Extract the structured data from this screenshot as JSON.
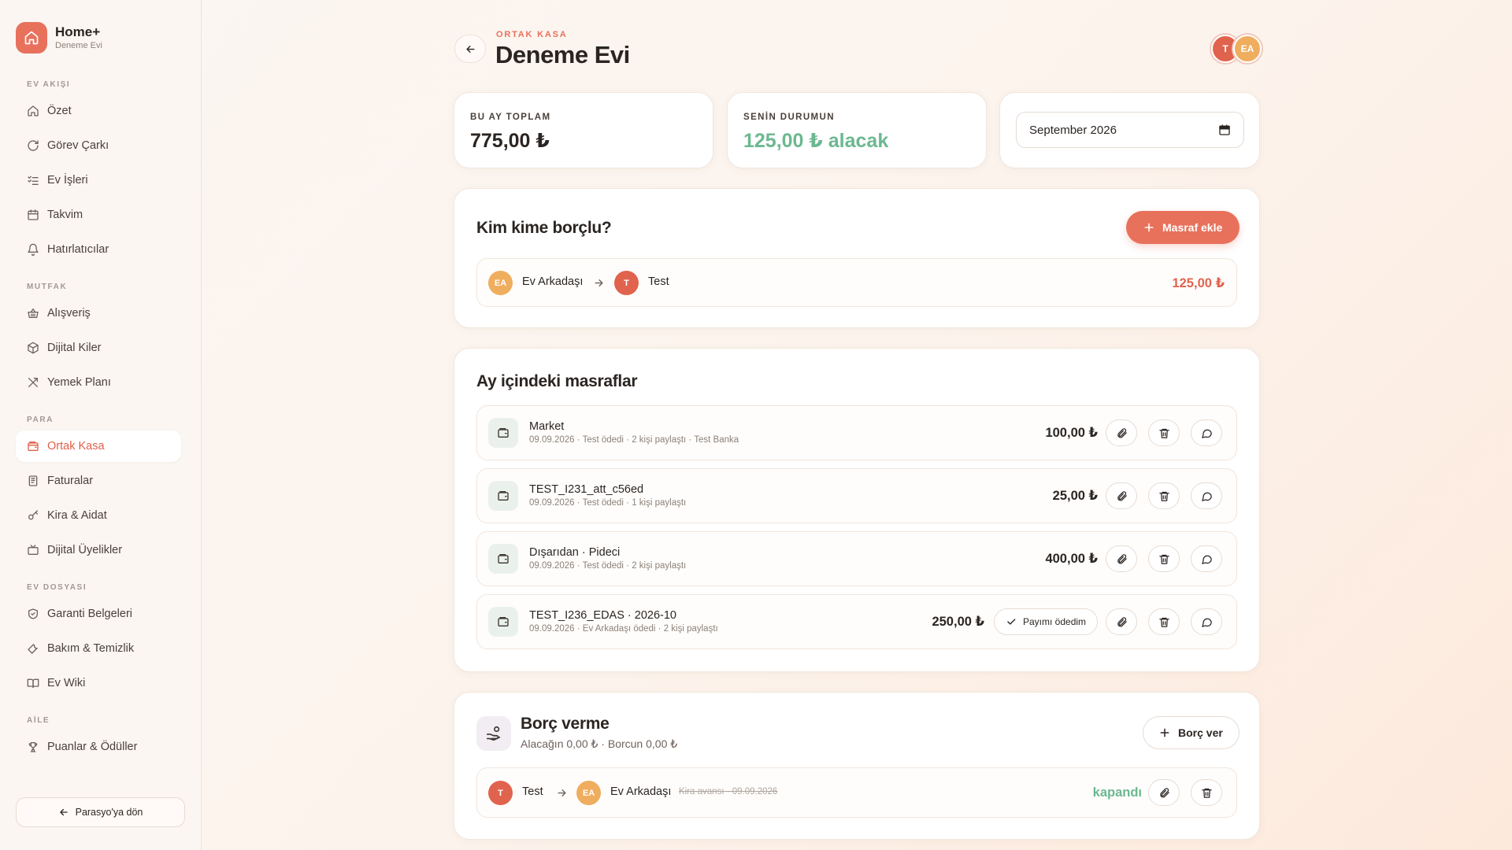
{
  "brand": {
    "title": "Home+",
    "subtitle": "Deneme Evi"
  },
  "sidebar": {
    "sections": [
      {
        "label": "EV AKIŞI",
        "items": [
          {
            "label": "Özet",
            "icon": "home-icon"
          },
          {
            "label": "Görev Çarkı",
            "icon": "refresh-icon"
          },
          {
            "label": "Ev İşleri",
            "icon": "checklist-icon"
          },
          {
            "label": "Takvim",
            "icon": "calendar-icon"
          },
          {
            "label": "Hatırlatıcılar",
            "icon": "bell-icon"
          }
        ]
      },
      {
        "label": "MUTFAK",
        "items": [
          {
            "label": "Alışveriş",
            "icon": "basket-icon"
          },
          {
            "label": "Dijital Kiler",
            "icon": "box-icon"
          },
          {
            "label": "Yemek Planı",
            "icon": "utensils-icon"
          }
        ]
      },
      {
        "label": "PARA",
        "items": [
          {
            "label": "Ortak Kasa",
            "icon": "wallet-icon",
            "active": true
          },
          {
            "label": "Faturalar",
            "icon": "receipt-icon"
          },
          {
            "label": "Kira & Aidat",
            "icon": "key-icon"
          },
          {
            "label": "Dijital Üyelikler",
            "icon": "tv-icon"
          }
        ]
      },
      {
        "label": "EV DOSYASI",
        "items": [
          {
            "label": "Garanti Belgeleri",
            "icon": "shield-icon"
          },
          {
            "label": "Bakım & Temizlik",
            "icon": "wrench-icon"
          },
          {
            "label": "Ev Wiki",
            "icon": "book-icon"
          }
        ]
      },
      {
        "label": "AİLE",
        "items": [
          {
            "label": "Puanlar & Ödüller",
            "icon": "trophy-icon"
          }
        ]
      }
    ],
    "back_label": "Parasyo'ya dön"
  },
  "header": {
    "eyebrow": "ORTAK KASA",
    "title": "Deneme Evi",
    "avatars": [
      "T",
      "EA"
    ]
  },
  "stats": {
    "month_total_label": "BU AY TOPLAM",
    "month_total_value": "775,00 ₺",
    "status_label": "SENİN DURUMUN",
    "status_value": "125,00 ₺ alacak",
    "month_picker": "September 2026"
  },
  "debts": {
    "title": "Kim kime borçlu?",
    "add_button": "Masraf ekle",
    "rows": [
      {
        "from_initials": "EA",
        "from_name": "Ev Arkadaşı",
        "to_initials": "T",
        "to_name": "Test",
        "amount": "125,00 ₺"
      }
    ]
  },
  "expenses": {
    "title": "Ay içindeki masraflar",
    "items": [
      {
        "title": "Market",
        "meta": "09.09.2026 · Test ödedi · 2 kişi paylaştı · Test Banka",
        "amount": "100,00 ₺"
      },
      {
        "title": "TEST_I231_att_c56ed",
        "meta": "09.09.2026 · Test ödedi · 1 kişi paylaştı",
        "amount": "25,00 ₺"
      },
      {
        "title": "Dışarıdan · Pideci",
        "meta": "09.09.2026 · Test ödedi · 2 kişi paylaştı",
        "amount": "400,00 ₺"
      },
      {
        "title": "TEST_I236_EDAS · 2026-10",
        "meta": "09.09.2026 · Ev Arkadaşı ödedi · 2 kişi paylaştı",
        "amount": "250,00 ₺",
        "pay_button": "Payımı ödedim"
      }
    ]
  },
  "loans": {
    "title": "Borç verme",
    "summary": "Alacağın 0,00 ₺ · Borcun 0,00 ₺",
    "give_button": "Borç ver",
    "rows": [
      {
        "from_initials": "T",
        "from_name": "Test",
        "to_initials": "EA",
        "to_name": "Ev Arkadaşı",
        "note": "Kira avansı · 09.09.2026",
        "status": "kapandı"
      }
    ]
  },
  "colors": {
    "accent": "#e8715c",
    "positive": "#6cb890",
    "avatar_t": "#e0634e",
    "avatar_ea": "#efad5e"
  }
}
